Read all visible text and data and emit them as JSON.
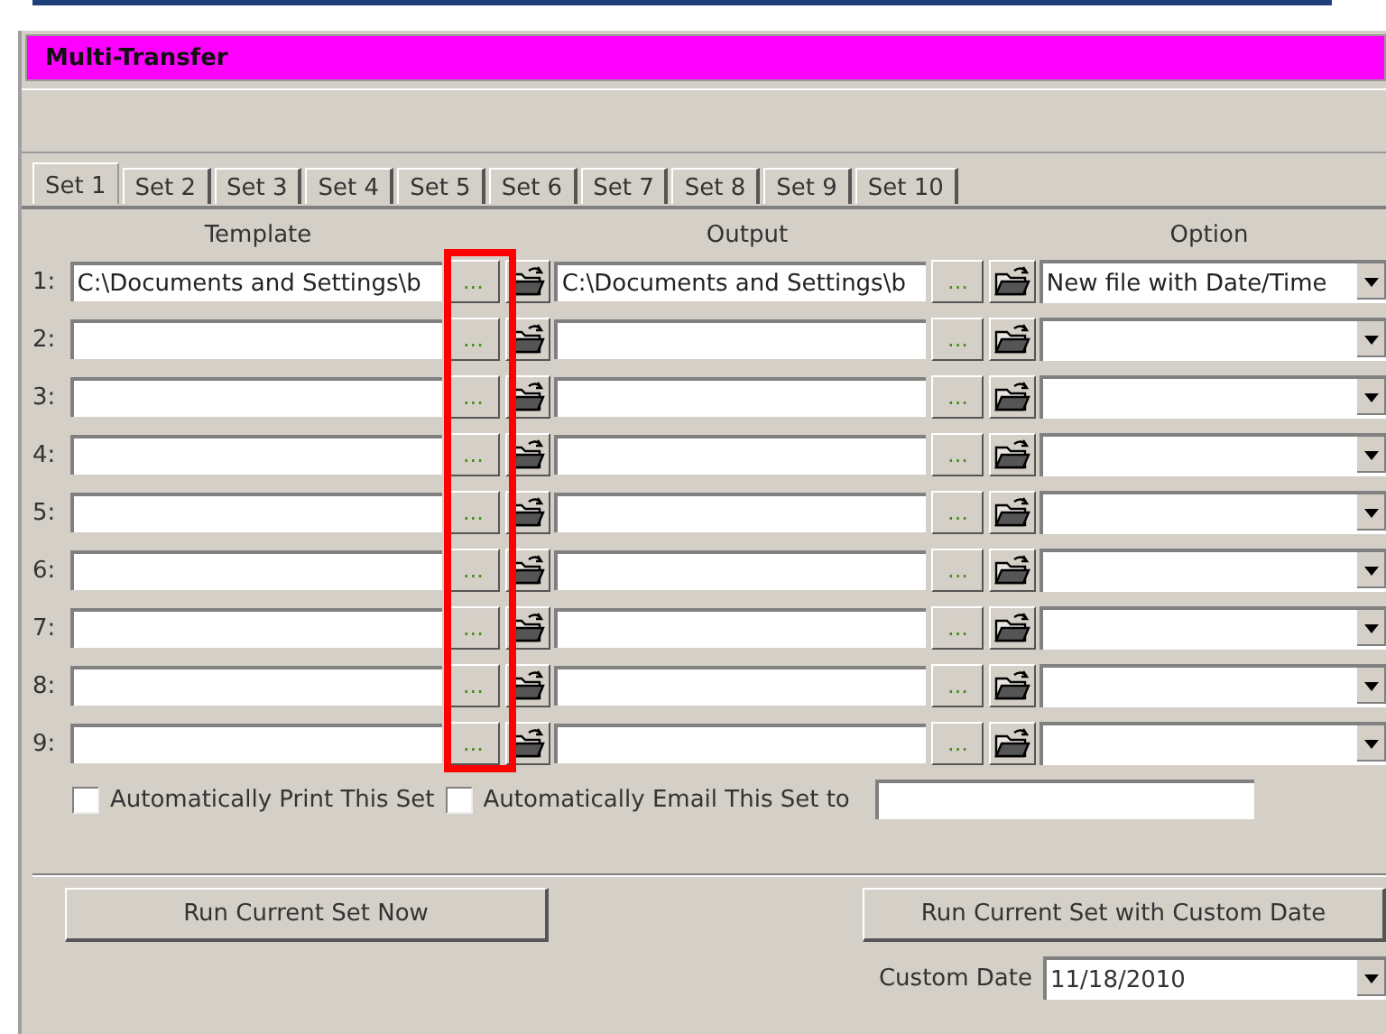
{
  "window": {
    "title": "Multi-Transfer"
  },
  "tabs": [
    {
      "label": "Set 1",
      "selected": true
    },
    {
      "label": "Set 2",
      "selected": false
    },
    {
      "label": "Set 3",
      "selected": false
    },
    {
      "label": "Set 4",
      "selected": false
    },
    {
      "label": "Set 5",
      "selected": false
    },
    {
      "label": "Set 6",
      "selected": false
    },
    {
      "label": "Set 7",
      "selected": false
    },
    {
      "label": "Set 8",
      "selected": false
    },
    {
      "label": "Set 9",
      "selected": false
    },
    {
      "label": "Set 10",
      "selected": false
    }
  ],
  "columns": [
    "Template",
    "Output",
    "Option"
  ],
  "rows": [
    {
      "label": "1:",
      "template": "C:\\Documents and Settings\\b",
      "template_browse": "...",
      "output": "C:\\Documents and Settings\\b",
      "output_browse": "...",
      "option": "New file with Date/Time"
    },
    {
      "label": "2:",
      "template_browse": "...",
      "output_browse": "..."
    },
    {
      "label": "3:",
      "template_browse": "...",
      "output_browse": "..."
    },
    {
      "label": "4:",
      "template_browse": "...",
      "output_browse": "..."
    },
    {
      "label": "5:",
      "template_browse": "...",
      "output_browse": "..."
    },
    {
      "label": "6:",
      "template_browse": "...",
      "output_browse": "..."
    },
    {
      "label": "7:",
      "template_browse": "...",
      "output_browse": "..."
    },
    {
      "label": "8:",
      "template_browse": "...",
      "output_browse": "..."
    },
    {
      "label": "9:",
      "template_browse": "...",
      "output_browse": "..."
    }
  ],
  "highlight": {
    "kind": "template_browse"
  },
  "print_set": {
    "label": "Automatically Print This Set",
    "checked": false
  },
  "email_set": {
    "label": "Automatically Email This Set to",
    "checked": false
  },
  "run_now": "Run Current Set Now",
  "run_custom": "Run Current Set with Custom Date",
  "custom_date": {
    "label": "Custom Date",
    "value": "11/18/2010"
  }
}
